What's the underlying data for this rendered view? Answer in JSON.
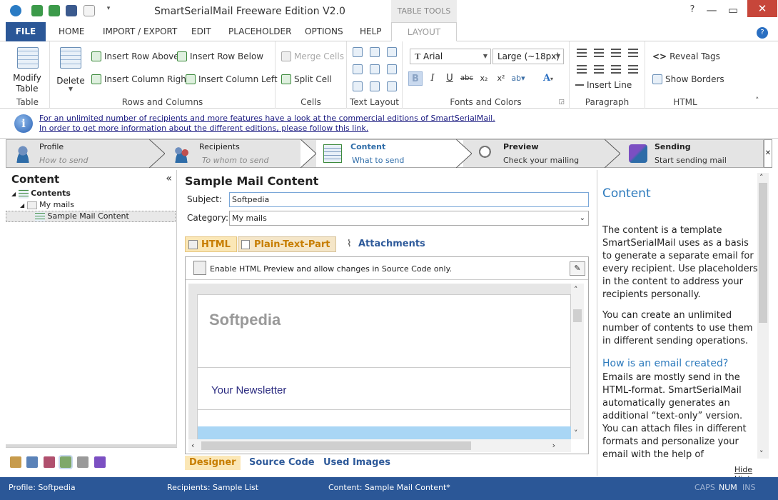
{
  "app": {
    "title": "SmartSerialMail Freeware Edition V2.0",
    "context_tab": "TABLE TOOLS"
  },
  "menu": {
    "tabs": [
      "FILE",
      "HOME",
      "IMPORT / EXPORT",
      "EDIT",
      "PLACEHOLDER",
      "OPTIONS",
      "HELP",
      "LAYOUT"
    ]
  },
  "ribbon": {
    "table": {
      "modify": "Modify Table",
      "delete": "Delete",
      "label": "Table"
    },
    "rows": {
      "insert_row_above": "Insert Row Above",
      "insert_row_below": "Insert Row Below",
      "insert_col_right": "Insert Column Right",
      "insert_col_left": "Insert Column Left",
      "label": "Rows and Columns"
    },
    "cells": {
      "merge": "Merge Cells",
      "split": "Split Cell",
      "label": "Cells"
    },
    "text_layout": {
      "label": "Text Layout"
    },
    "fonts": {
      "font": "Arial",
      "size": "Large (~18px)",
      "label": "Fonts and Colors"
    },
    "paragraph": {
      "insert_line": "Insert Line",
      "label": "Paragraph"
    },
    "html": {
      "reveal": "Reveal Tags",
      "borders": "Show Borders",
      "label": "HTML"
    }
  },
  "info": {
    "line1": "For an unlimited number of recipients and more features have a look at the commercial editions of SmartSerialMail.",
    "line2": "In order to get more information about the different editions, please follow this link."
  },
  "steps": [
    {
      "title": "Profile",
      "sub": "How to send"
    },
    {
      "title": "Recipients",
      "sub": "To whom to send"
    },
    {
      "title": "Content",
      "sub": "What to send"
    },
    {
      "title": "Preview",
      "sub": "Check your mailing"
    },
    {
      "title": "Sending",
      "sub": "Start sending mail"
    }
  ],
  "left": {
    "header": "Content",
    "tree": {
      "root": "Contents",
      "folder": "My mails",
      "item": "Sample Mail Content"
    }
  },
  "center": {
    "title": "Sample Mail Content",
    "subject_label": "Subject:",
    "subject_value": "Softpedia",
    "category_label": "Category:",
    "category_value": "My mails",
    "tabs": {
      "html": "HTML",
      "plain": "Plain-Text-Part",
      "attachments": "Attachments"
    },
    "toolbar_text": "Enable HTML Preview and allow changes in Source Code only.",
    "preview": {
      "heading": "Softpedia",
      "subheading": "Your Newsletter"
    },
    "bottom_tabs": {
      "designer": "Designer",
      "source": "Source Code",
      "images": "Used Images"
    }
  },
  "hints": {
    "title": "Content",
    "p1": "The content is a template SmartSerialMail uses as a basis to generate a separate email for every recipient. Use placeholders in the content to address your recipients personally.",
    "p2": "You can create an unlimited number of contents to use them in different sending operations.",
    "q": "How is an email created?",
    "p3": "Emails are mostly send in the HTML-format. SmartSerialMail automatically generates an additional “text-only” version. You can attach files in different formats and personalize your email with the help of",
    "hide": "Hide Hints"
  },
  "status": {
    "profile": "Profile: Softpedia",
    "recipients": "Recipients: Sample List",
    "content": "Content: Sample Mail Content*",
    "caps": "CAPS",
    "num": "NUM",
    "ins": "INS"
  },
  "colors": {
    "accent": "#2b5797",
    "tab_orange": "#c77d00",
    "link_blue": "#2e7bbd"
  }
}
